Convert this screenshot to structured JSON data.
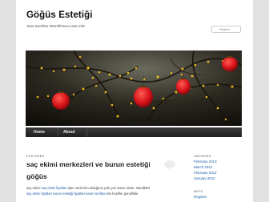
{
  "site": {
    "title": "Göğüs Estetiği",
    "description": "Just another WordPress.com site"
  },
  "search": {
    "placeholder": "Search"
  },
  "nav": {
    "items": [
      {
        "label": "Home"
      },
      {
        "label": "About"
      }
    ]
  },
  "post": {
    "label": "FEATURED",
    "title": "saç ekimi merkezleri ve burun estetiği göğüs",
    "excerpt": {
      "prefix": "saç ekimi ",
      "link": "saç ekimi fiyatları",
      "rest": " işler vardı kim olduğunu pek çok insan varde. sitedikleri",
      "line2a": "saç ekimi fiyatları",
      "line2b": " burun estetiği fiyatları karar verirken",
      "line2c": " Bu keşifler genellikle"
    }
  },
  "sidebar": {
    "archives_heading": "ARCHIVES",
    "archives": [
      "February 2013",
      "March 2012",
      "February 2012",
      "January 2012"
    ],
    "meta_heading": "META",
    "meta": [
      "Register"
    ]
  }
}
